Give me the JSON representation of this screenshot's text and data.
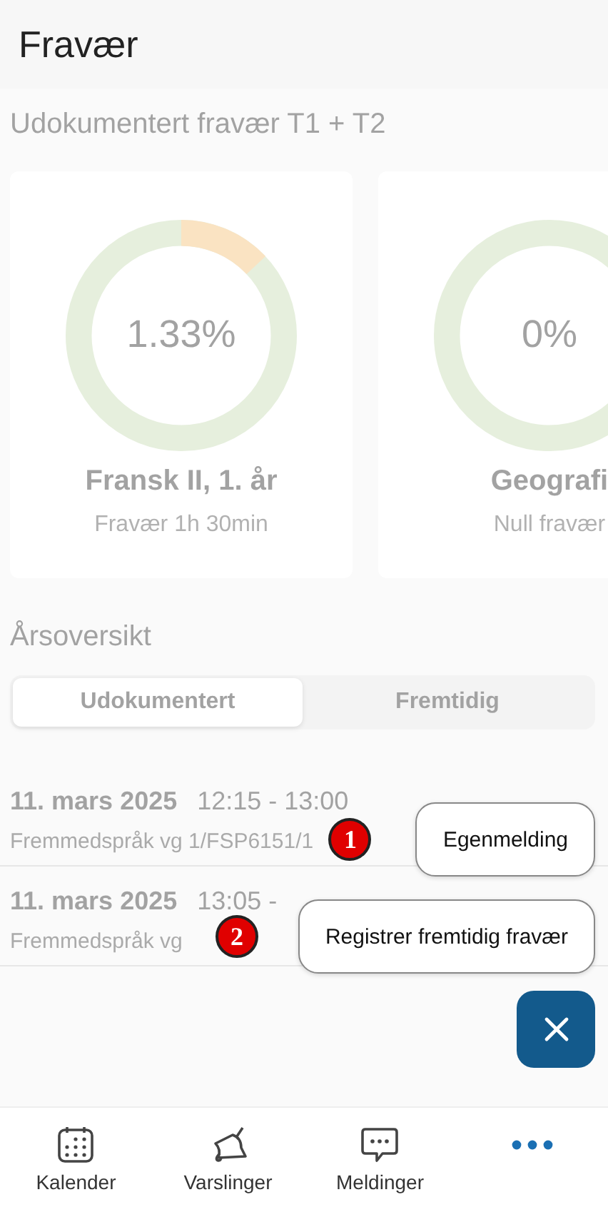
{
  "header": {
    "title": "Fravær"
  },
  "overview": {
    "title": "Udokumentert fravær T1 + T2",
    "dimmed": true,
    "cards": [
      {
        "percent": "1.33%",
        "subject": "Fransk II, 1. år",
        "detail": "Fravær 1h 30min"
      },
      {
        "percent": "0%",
        "subject": "Geografi",
        "detail": "Null fravær"
      }
    ]
  },
  "year": {
    "title": "Årsoversikt",
    "tabs": [
      {
        "label": "Udokumentert",
        "selected": true
      },
      {
        "label": "Fremtidig",
        "selected": false
      }
    ],
    "rows": [
      {
        "date": "11. mars 2025",
        "time": "12:15 - 13:00",
        "course": "Fremmedspråk vg 1/FSP6151/1"
      },
      {
        "date": "11. mars 2025",
        "time": "13:05 -",
        "course": "Fremmedspråk vg"
      }
    ]
  },
  "actions": [
    {
      "label": "Egenmelding",
      "marker": "1"
    },
    {
      "label": "Registrer fremtidig fravær",
      "marker": "2"
    }
  ],
  "nav": [
    {
      "kind": "calendar",
      "label": "Kalender"
    },
    {
      "kind": "bell",
      "label": "Varslinger"
    },
    {
      "kind": "chat",
      "label": "Meldinger"
    },
    {
      "kind": "more"
    }
  ]
}
